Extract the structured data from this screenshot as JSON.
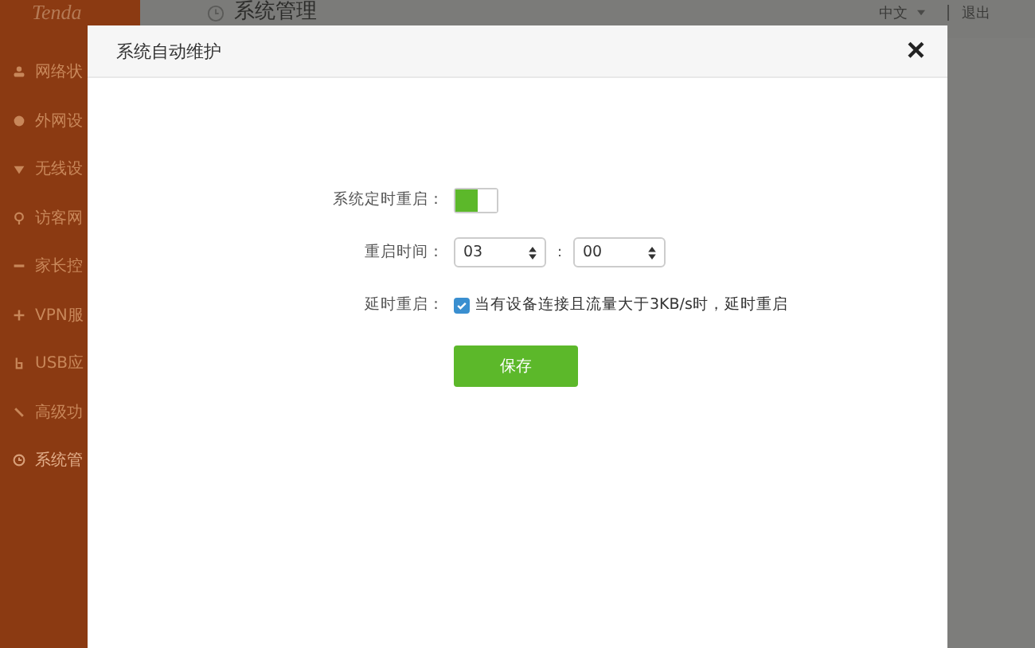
{
  "logo": "Tenda",
  "sidebar": {
    "items": [
      {
        "label": "网络状",
        "selected": false
      },
      {
        "label": "外网设",
        "selected": false
      },
      {
        "label": "无线设",
        "selected": false
      },
      {
        "label": "访客网",
        "selected": false
      },
      {
        "label": "家长控",
        "selected": false
      },
      {
        "label": "VPN服",
        "selected": false
      },
      {
        "label": "USB应",
        "selected": false
      },
      {
        "label": "高级功",
        "selected": false
      },
      {
        "label": "系统管",
        "selected": true
      }
    ]
  },
  "header": {
    "title": "系统管理",
    "language": "中文",
    "logout": "退出"
  },
  "dialog": {
    "title": "系统自动维护",
    "close": "×",
    "rows": [
      {
        "kind": "switch",
        "label": "系统定时重启：",
        "on": true
      },
      {
        "kind": "time",
        "label": "重启时间：",
        "hour": "03",
        "separator": "：",
        "minute": "00"
      },
      {
        "kind": "checkbox",
        "label": "延时重启：",
        "checked": true,
        "text": "当有设备连接且流量大于3KB/s时，延时重启"
      }
    ],
    "save": "保存"
  }
}
